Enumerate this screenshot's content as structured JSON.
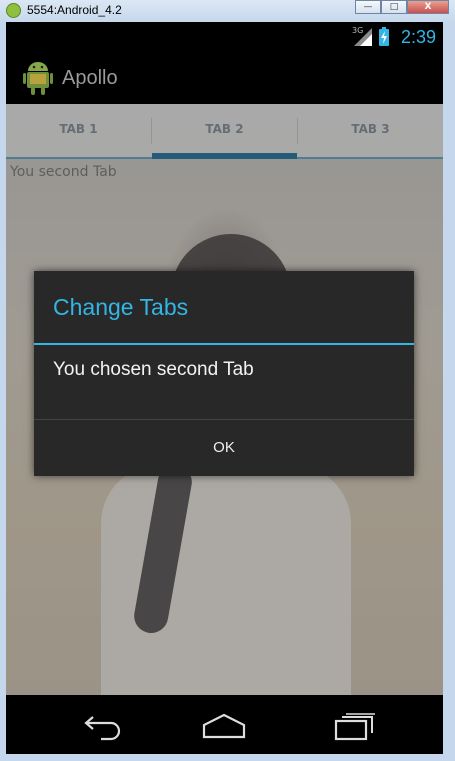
{
  "window": {
    "title": "5554:Android_4.2",
    "minimize": "—",
    "maximize": "□",
    "close": "X"
  },
  "status_bar": {
    "network": "3G",
    "time": "2:39"
  },
  "action_bar": {
    "app_title": "Apollo"
  },
  "tabs": [
    {
      "label": "TAB 1",
      "selected": false
    },
    {
      "label": "TAB 2",
      "selected": true
    },
    {
      "label": "TAB 3",
      "selected": false
    }
  ],
  "content": {
    "text": "You second Tab"
  },
  "dialog": {
    "title": "Change Tabs",
    "message": "You chosen second Tab",
    "ok_label": "OK"
  },
  "colors": {
    "accent": "#33b5e5",
    "dialog_bg": "#282828",
    "tab_indicator": "#235b79"
  },
  "icons": {
    "window_icon": "android-emulator-icon",
    "app_icon": "android-robot-icon",
    "back": "back-icon",
    "home": "home-icon",
    "recents": "recent-apps-icon"
  }
}
